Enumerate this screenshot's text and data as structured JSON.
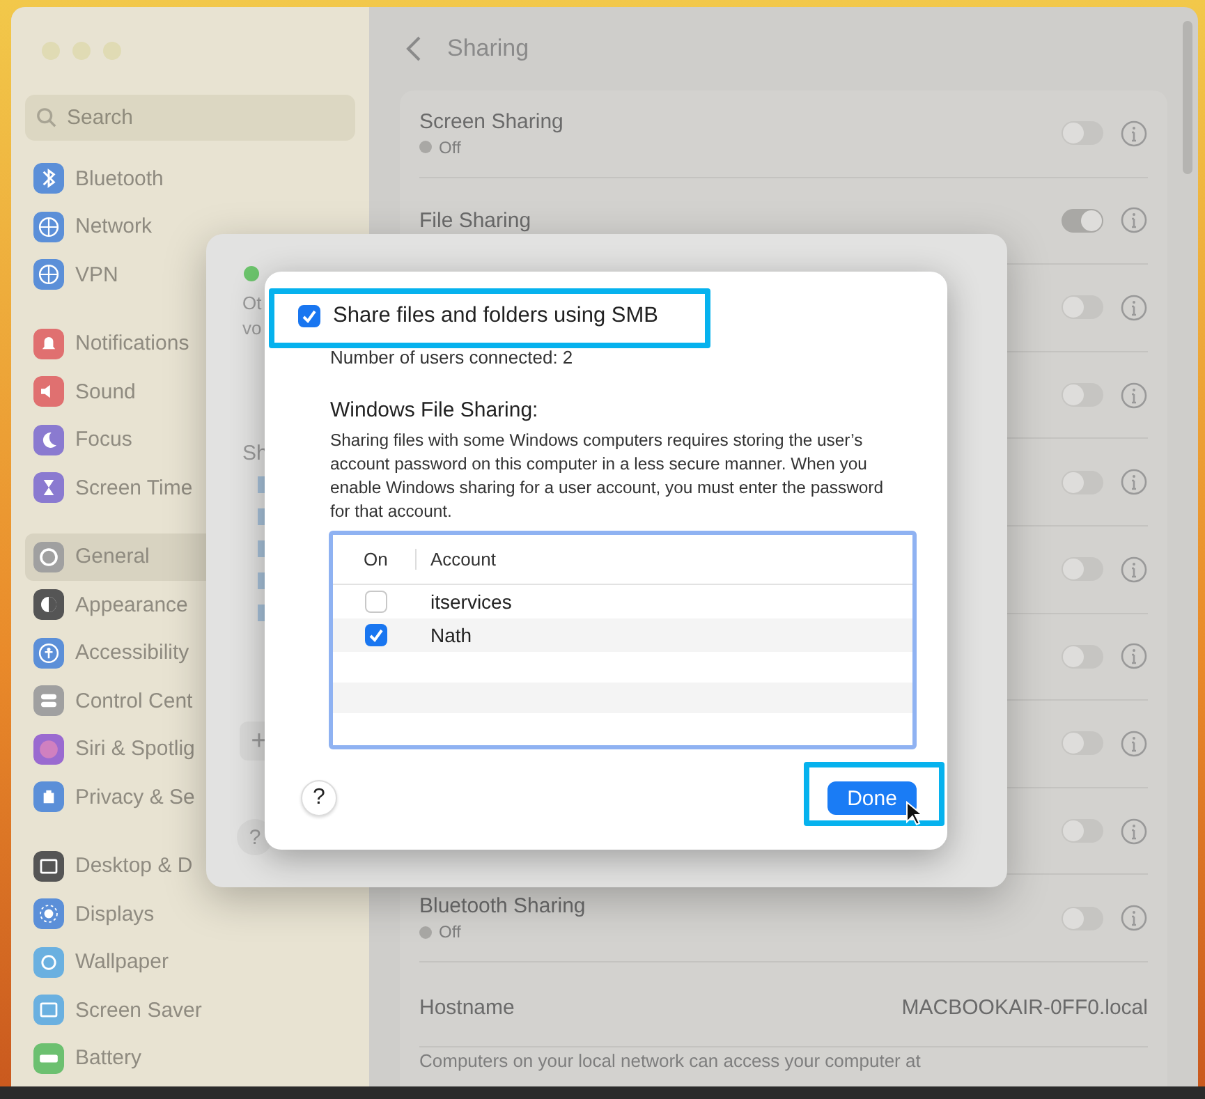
{
  "window": {
    "title": "Sharing"
  },
  "sidebar": {
    "search": {
      "placeholder": "Search"
    },
    "groups": [
      [
        {
          "label": "Bluetooth",
          "color": "#5b8fd8",
          "selected": false
        },
        {
          "label": "Network",
          "color": "#5b8fd8",
          "selected": false
        },
        {
          "label": "VPN",
          "color": "#5b8fd8",
          "selected": false
        }
      ],
      [
        {
          "label": "Notifications",
          "color": "#e07070",
          "selected": false
        },
        {
          "label": "Sound",
          "color": "#e07070",
          "selected": false
        },
        {
          "label": "Focus",
          "color": "#8a7ad0",
          "selected": false
        },
        {
          "label": "Screen Time",
          "color": "#8a7ad0",
          "selected": false
        }
      ],
      [
        {
          "label": "General",
          "color": "#a0a0a0",
          "selected": true
        },
        {
          "label": "Appearance",
          "color": "#555555",
          "selected": false
        },
        {
          "label": "Accessibility",
          "color": "#5b8fd8",
          "selected": false
        },
        {
          "label": "Control Cent",
          "color": "#a0a0a0",
          "selected": false
        },
        {
          "label": "Siri & Spotlig",
          "color": "#9a6ad0",
          "selected": false
        },
        {
          "label": "Privacy & Se",
          "color": "#5b8fd8",
          "selected": false
        }
      ],
      [
        {
          "label": "Desktop & D",
          "color": "#555555",
          "selected": false
        },
        {
          "label": "Displays",
          "color": "#5b8fd8",
          "selected": false
        },
        {
          "label": "Wallpaper",
          "color": "#6ab0e0",
          "selected": false
        },
        {
          "label": "Screen Saver",
          "color": "#6ab0e0",
          "selected": false
        },
        {
          "label": "Battery",
          "color": "#6cc070",
          "selected": false
        }
      ]
    ]
  },
  "services": [
    {
      "label": "Screen Sharing",
      "status": "Off",
      "on": false
    },
    {
      "label": "File Sharing",
      "on": true
    },
    {
      "on": false
    },
    {
      "on": false
    },
    {
      "on": false
    },
    {
      "on": false
    },
    {
      "on": false
    },
    {
      "on": false
    },
    {
      "on": false
    },
    {
      "label": "Bluetooth Sharing",
      "status": "Off",
      "on": false
    }
  ],
  "hostname": {
    "label": "Hostname",
    "value": "MACBOOKAIR-0FF0.local",
    "note": "Computers on your local network can access your computer at"
  },
  "back_sheet": {
    "status_on": true,
    "fragments": [
      "Ot",
      "vo"
    ],
    "section": "Sh",
    "add": "+",
    "help": "?"
  },
  "smb_sheet": {
    "smb": {
      "label": "Share files and folders using SMB",
      "checked": true,
      "highlighted": true
    },
    "connected": "Number of users connected: 2",
    "heading": "Windows File Sharing:",
    "description": "Sharing files with some Windows computers requires storing the user’s account password on this computer in a less secure manner. When you enable Windows sharing for a user account, you must enter the password for that account.",
    "table": {
      "columns": [
        "On",
        "Account"
      ],
      "rows": [
        {
          "on": false,
          "account": "itservices"
        },
        {
          "on": true,
          "account": "Nath"
        }
      ]
    },
    "help": "?",
    "done": {
      "label": "Done",
      "highlighted": true
    }
  }
}
